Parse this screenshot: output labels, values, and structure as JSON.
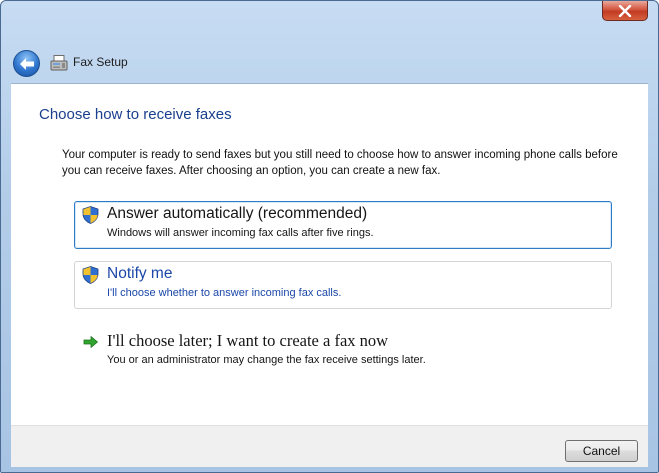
{
  "window": {
    "close_glyph": "x",
    "close_icon": "close-icon",
    "title": "Fax Setup"
  },
  "nav": {
    "back_icon": "back-arrow-icon",
    "app_icon": "fax-icon"
  },
  "heading": "Choose how to receive faxes",
  "intro": "Your computer is ready to send faxes but you still need to choose how to answer incoming phone calls before you can receive faxes. After choosing an option, you can create a new fax.",
  "options": [
    {
      "icon": "uac-shield-icon",
      "title": "Answer automatically (recommended)",
      "desc": "Windows will answer incoming fax calls after five rings."
    },
    {
      "icon": "uac-shield-icon",
      "title": "Notify me",
      "desc": "I'll choose whether to answer incoming fax calls."
    },
    {
      "icon": "green-arrow-icon",
      "title": "I'll choose later; I want to create a fax now",
      "desc": "You or an administrator may change the fax receive settings later."
    }
  ],
  "footer": {
    "cancel_label": "Cancel"
  },
  "colors": {
    "heading": "#1a3f8c",
    "link_hover": "#1a47a8",
    "selected_border": "#2e7dc4",
    "close_button": "#c23b22"
  }
}
